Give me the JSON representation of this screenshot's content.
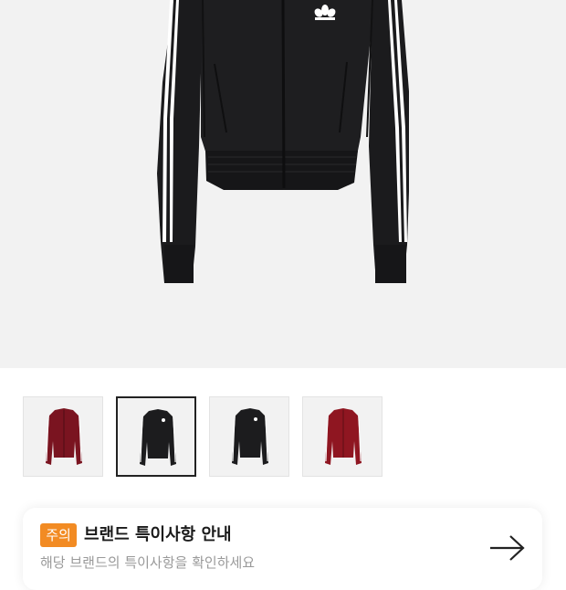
{
  "product": {
    "hero_image_icon": "black-track-jacket-front",
    "hero_background": "#f2f2f2",
    "logo_icon": "adidas-trefoil-icon"
  },
  "thumbnails": [
    {
      "icon": "burgundy-track-jacket",
      "color": "#7a1420",
      "selected": false
    },
    {
      "icon": "black-track-jacket",
      "color": "#1c1c1e",
      "selected": true
    },
    {
      "icon": "black-track-jacket-alt",
      "color": "#1c1c1e",
      "selected": false
    },
    {
      "icon": "red-track-jacket",
      "color": "#8f1621",
      "selected": false
    }
  ],
  "notice": {
    "badge": "주의",
    "badge_color": "#f28b23",
    "title": "브랜드 특이사항 안내",
    "subtitle": "해당 브랜드의 특이사항을 확인하세요",
    "arrow_icon": "arrow-right-icon"
  }
}
